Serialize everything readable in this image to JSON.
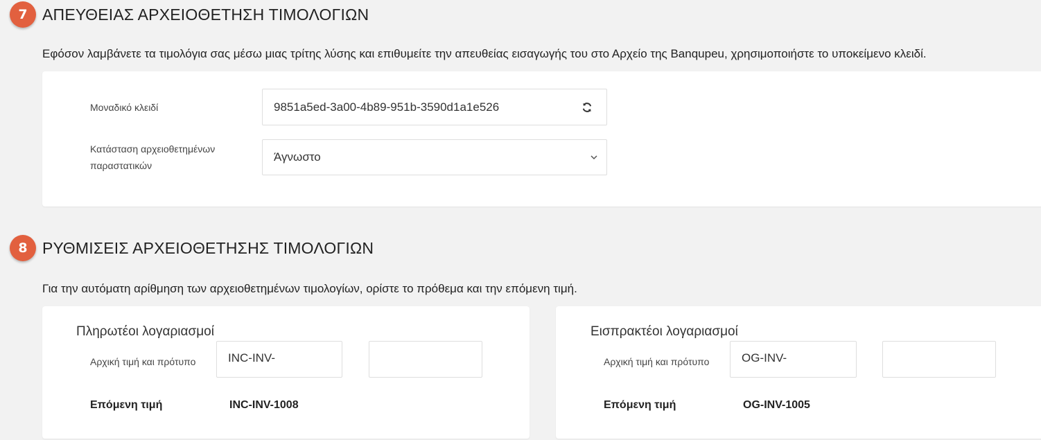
{
  "section7": {
    "number": "7",
    "title": "ΑΠΕΥΘΕΙΑΣ ΑΡΧΕΙΟΘΕΤΗΣΗ ΤΙΜΟΛΟΓΙΩΝ",
    "description": "Εφόσον λαμβάνετε τα τιμολόγια σας μέσω μιας τρίτης λύσης και επιθυμείτε την απευθείας εισαγωγής του στο Αρχείο της Banqupeu, χρησιμοποιήστε το υποκείμενο κλειδί.",
    "unique_key_label": "Μοναδικό κλειδί",
    "unique_key_value": "9851a5ed-3a00-4b89-951b-3590d1a1e526",
    "refresh_icon": "refresh-icon",
    "status_label_line1": "Κατάσταση αρχειοθετημένων",
    "status_label_line2": "παραστατικών",
    "status_value": "Άγνωστο"
  },
  "section8": {
    "number": "8",
    "title": "ΡΥΘΜΙΣΕΙΣ ΑΡΧΕΙΟΘΕΤΗΣΗΣ ΤΙΜΟΛΟΓΙΩΝ",
    "description": "Για την αυτόματη αρίθμηση των αρχειοθετημένων τιμολογίων, ορίστε το πρόθεμα και την επόμενη τιμή.",
    "payables": {
      "title": "Πληρωτέοι λογαριασμοί",
      "start_label": "Αρχική τιμή και πρότυπο",
      "prefix_value": "INC-INV-",
      "number_value": "",
      "next_label": "Επόμενη τιμή",
      "next_value": "INC-INV-1008"
    },
    "receivables": {
      "title": "Εισπρακτέοι λογαριασμοί",
      "start_label": "Αρχική τιμή και πρότυπο",
      "prefix_value": "OG-INV-",
      "number_value": "",
      "next_label": "Επόμενη τιμή",
      "next_value": "OG-INV-1005"
    }
  },
  "colors": {
    "badge": "#e2603f",
    "background": "#f2f2f2",
    "card": "#ffffff"
  }
}
